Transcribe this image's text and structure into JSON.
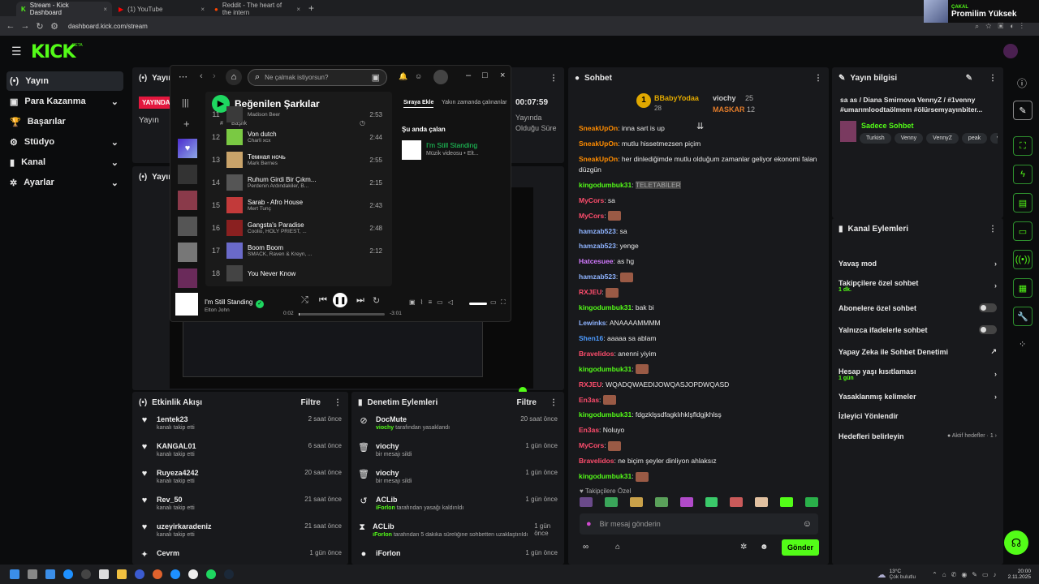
{
  "browser": {
    "tabs": [
      {
        "label": "Stream - Kick Dashboard",
        "active": true
      },
      {
        "label": "(1) YouTube",
        "active": false
      },
      {
        "label": "Reddit - The heart of the intern",
        "active": false
      }
    ],
    "url": "dashboard.kick.com/stream"
  },
  "promo": {
    "channel": "ÇAKAL",
    "title": "Promilim Yüksek"
  },
  "kick": {
    "logo": "KICK",
    "beta": "BETA",
    "nav": [
      {
        "label": "Yayın",
        "icon": "broadcast-icon"
      },
      {
        "label": "Para Kazanma",
        "icon": "money-icon"
      },
      {
        "label": "Başarılar",
        "icon": "trophy-icon"
      },
      {
        "label": "Stüdyo",
        "icon": "studio-icon"
      },
      {
        "label": "Kanal",
        "icon": "channel-icon"
      },
      {
        "label": "Ayarlar",
        "icon": "gear-icon"
      }
    ],
    "stream_panel": {
      "title": "Yayın",
      "live": "YAYINDA",
      "label": "Yayın",
      "timer": "00:07:59",
      "timer_label": "Yayında Olduğu Süre",
      "preview_title": "Yayın"
    },
    "activity": {
      "title": "Etkinlik Akışı",
      "filter": "Filtre",
      "items": [
        {
          "user": "1entek23",
          "action": "kanalı takip etti",
          "time": "2 saat önce"
        },
        {
          "user": "KANGAL01",
          "action": "kanalı takip etti",
          "time": "6 saat önce"
        },
        {
          "user": "Ruyeza4242",
          "action": "kanalı takip etti",
          "time": "20 saat önce"
        },
        {
          "user": "Rev_50",
          "action": "kanalı takip etti",
          "time": "21 saat önce"
        },
        {
          "user": "uzeyirkaradeniz",
          "action": "kanalı takip etti",
          "time": "21 saat önce"
        },
        {
          "user": "Cevrm",
          "action": "",
          "time": "1 gün önce"
        }
      ]
    },
    "moderation": {
      "title": "Denetim Eylemleri",
      "filter": "Filtre",
      "items": [
        {
          "user": "DocMute",
          "by": "viochy",
          "action": "tarafından yasaklandı",
          "time": "20 saat önce"
        },
        {
          "user": "viochy",
          "by": "",
          "action": "bir mesajı sildi",
          "time": "1 gün önce"
        },
        {
          "user": "viochy",
          "by": "",
          "action": "bir mesajı sildi",
          "time": "1 gün önce"
        },
        {
          "user": "ACLib",
          "by": "iForlon",
          "action": "tarafından yasağı kaldırıldı",
          "time": "1 gün önce"
        },
        {
          "user": "ACLib",
          "by": "iForlon",
          "action": "tarafından 5 dakika süreliğine sohbetten uzaklaştırıldı",
          "time": "1 gün önce"
        },
        {
          "user": "iForlon",
          "by": "",
          "action": "",
          "time": "1 gün önce"
        }
      ]
    },
    "chat": {
      "title": "Sohbet",
      "top": [
        {
          "name": "BBabyYodaa",
          "count": "28"
        },
        {
          "name": "viochy",
          "count": "25"
        },
        {
          "name": "MASKAR",
          "count": "12"
        }
      ],
      "messages": [
        {
          "user": "SneakUpOn",
          "color": "#ff8c00",
          "text": "inna sart is up"
        },
        {
          "user": "SneakUpOn",
          "color": "#ff8c00",
          "text": "mutlu hissetmezsen piçim"
        },
        {
          "user": "SneakUpOn",
          "color": "#ff8c00",
          "text": "her dinlediğimde mutlu olduğum zamanlar geliyor ekonomi falan düzgün"
        },
        {
          "user": "kingodumbuk31",
          "color": "#53fc18",
          "text": "TELETABİLER"
        },
        {
          "user": "MyCors",
          "color": "#ff4d6d",
          "text": "sa"
        },
        {
          "user": "MyCors",
          "color": "#ff4d6d",
          "text": ""
        },
        {
          "user": "hamzab523",
          "color": "#8fb4ff",
          "text": "sa"
        },
        {
          "user": "hamzab523",
          "color": "#8fb4ff",
          "text": "yenge"
        },
        {
          "user": "Hatcesuee",
          "color": "#d37aff",
          "text": "as hg"
        },
        {
          "user": "hamzab523",
          "color": "#8fb4ff",
          "text": ""
        },
        {
          "user": "RXJEU",
          "color": "#ff4d6d",
          "text": ""
        },
        {
          "user": "kingodumbuk31",
          "color": "#53fc18",
          "text": "bak bi"
        },
        {
          "user": "Lewinks",
          "color": "#8fb4ff",
          "text": "ANAAAAMMMM"
        },
        {
          "user": "Shen16",
          "color": "#4d9bff",
          "text": "aaaaa sa ablam"
        },
        {
          "user": "Bravelidos",
          "color": "#ff4d6d",
          "text": "anenni yiyim"
        },
        {
          "user": "kingodumbuk31",
          "color": "#53fc18",
          "text": ""
        },
        {
          "user": "RXJEU",
          "color": "#ff4d6d",
          "text": "WQADQWAEDIJOWQASJOPDWQASD"
        },
        {
          "user": "En3as",
          "color": "#ff4d6d",
          "text": ""
        },
        {
          "user": "kingodumbuk31",
          "color": "#53fc18",
          "text": "fdgzklşsdfagklıhklşfldgjkhlsş"
        },
        {
          "user": "En3as",
          "color": "#ff4d6d",
          "text": "Noluyo"
        },
        {
          "user": "MyCors",
          "color": "#ff4d6d",
          "text": ""
        },
        {
          "user": "Bravelidos",
          "color": "#ff4d6d",
          "text": "ne biçim şeyler dinliyon ahlaksız"
        },
        {
          "user": "kingodumbuk31",
          "color": "#53fc18",
          "text": ""
        }
      ],
      "emote_label": "Takipçilere Özel",
      "placeholder": "Bir mesaj gönderin",
      "send": "Gönder"
    },
    "info": {
      "title": "Yayın bilgisi",
      "stream_title": "sa as / Diana Smirnova VennyZ / #1venny #umarımloodtaölmem #ölürsemyayınbiter...",
      "category": "Sadece Sohbet",
      "tags": [
        "Turkish",
        "Venny",
        "VennyZ",
        "peak",
        "va"
      ]
    },
    "channel_actions": {
      "title": "Kanal Eylemleri",
      "items": [
        {
          "label": "Yavaş mod",
          "sub": "",
          "right": "›"
        },
        {
          "label": "Takipçilere özel sohbet",
          "sub": "1 dk.",
          "right": "›"
        },
        {
          "label": "Abonelere özel sohbet",
          "sub": "",
          "right": "toggle"
        },
        {
          "label": "Yalnızca ifadelerle sohbet",
          "sub": "",
          "right": "toggle"
        },
        {
          "label": "Yapay Zeka ile Sohbet Denetimi",
          "sub": "",
          "right": "↗"
        },
        {
          "label": "Hesap yaşı kısıtlaması",
          "sub": "1 gün",
          "right": "›"
        },
        {
          "label": "Yasaklanmış kelimeler",
          "sub": "",
          "right": "›"
        },
        {
          "label": "İzleyici Yönlendir",
          "sub": "",
          "right": ""
        },
        {
          "label": "Hedefleri belirleyin",
          "sub": "",
          "right": "● Aktif hedefler · 1 ›"
        }
      ]
    }
  },
  "spotify": {
    "search_placeholder": "Ne çalmak istiyorsun?",
    "playlist": "Beğenilen Şarkılar",
    "col_title": "Başlık",
    "queue_tab": "Sıraya Ekle",
    "recent_tab": "Yakın zamanda çalınanlar",
    "now_playing_label": "Şu anda çalan",
    "now_title": "I'm Still Standing",
    "now_sub": "Müzik videosu • Elt...",
    "tracks": [
      {
        "n": "11",
        "title": "",
        "artist": "Madison Beer",
        "dur": "2:53"
      },
      {
        "n": "12",
        "title": "Von dutch",
        "artist": "Charli xcx",
        "dur": "2:44"
      },
      {
        "n": "13",
        "title": "Темная ночь",
        "artist": "Mark Bernes",
        "dur": "2:55"
      },
      {
        "n": "14",
        "title": "Ruhum Girdi Bir Çıkm...",
        "artist": "Perdenin Ardındakiler, B...",
        "dur": "2:15"
      },
      {
        "n": "15",
        "title": "Sarab - Afro House",
        "artist": "Mert Tunç",
        "dur": "2:43"
      },
      {
        "n": "16",
        "title": "Gangsta's Paradise",
        "artist": "Coolio, HOLY PRIEST, ...",
        "dur": "2:48"
      },
      {
        "n": "17",
        "title": "Boom Boom",
        "artist": "SMACK, Raven & Kreyn, ...",
        "dur": "2:12"
      },
      {
        "n": "18",
        "title": "You Never Know",
        "artist": "",
        "dur": ""
      }
    ],
    "player": {
      "title": "I'm Still Standing",
      "artist": "Elton John",
      "elapsed": "0:02",
      "remaining": "-3:01",
      "progress": 0.01
    }
  },
  "taskbar": {
    "weather": "13°C",
    "weather_sub": "Çok bulutlu",
    "time": "20:00",
    "date": "2.11.2025"
  }
}
